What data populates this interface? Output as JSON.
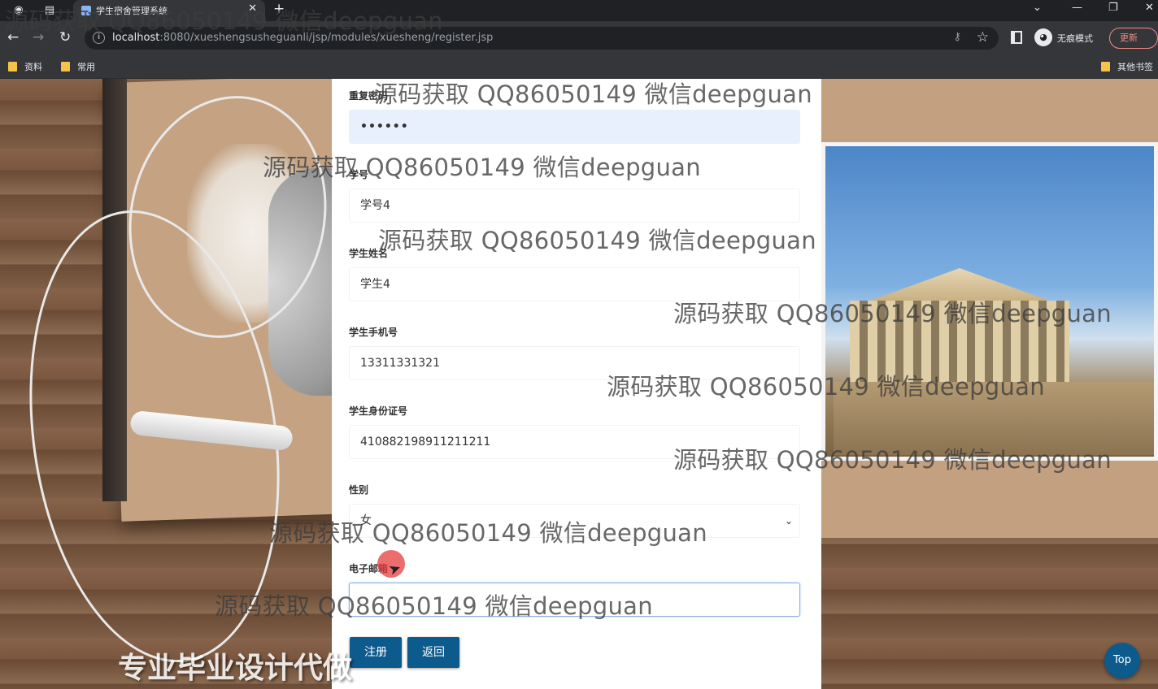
{
  "browser": {
    "tab_title": "学生宿舍管理系统",
    "url_host": "localhost",
    "url_rest": ":8080/xueshengsusheguanli/jsp/modules/xuesheng/register.jsp",
    "incognito_label": "无痕模式",
    "update_label": "更新",
    "bookmarks": [
      "资料",
      "常用"
    ],
    "other_bookmarks": "其他书签"
  },
  "form": {
    "fields": [
      {
        "label": "重复密码",
        "value": "••••••"
      },
      {
        "label": "学号",
        "value": "学号4"
      },
      {
        "label": "学生姓名",
        "value": "学生4"
      },
      {
        "label": "学生手机号",
        "value": "13311331321"
      },
      {
        "label": "学生身份证号",
        "value": "410882198911211211"
      },
      {
        "label": "性别",
        "value": "女"
      },
      {
        "label": "电子邮箱",
        "value": ""
      }
    ],
    "register_label": "注册",
    "back_label": "返回"
  },
  "top_label": "Top",
  "watermark": "源码获取 QQ86050149 微信deepguan",
  "promo_text": "专业毕业设计代做",
  "colors": {
    "primary_button": "#0d5a8c",
    "autofill_bg": "#e8f0fe"
  }
}
